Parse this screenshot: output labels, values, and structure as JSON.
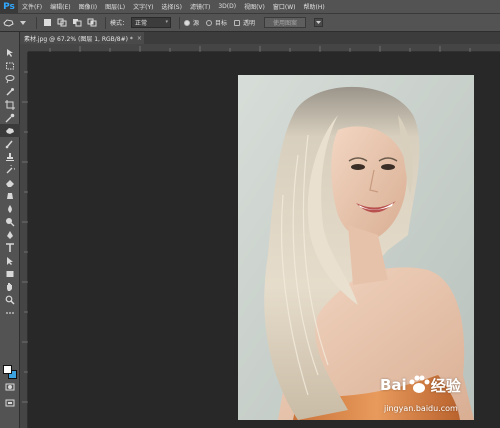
{
  "app": {
    "logo": "Ps"
  },
  "menu": [
    "文件(F)",
    "编辑(E)",
    "图像(I)",
    "图层(L)",
    "文字(Y)",
    "选择(S)",
    "滤镜(T)",
    "3D(D)",
    "视图(V)",
    "窗口(W)",
    "帮助(H)"
  ],
  "options": {
    "mode_label": "模式：",
    "mode_value": "正常",
    "radio_1": "源",
    "radio_2": "目标",
    "transparent_label": "透明",
    "use_pattern_label": "使用图案"
  },
  "document": {
    "tab_title": "素材.jpg @ 67.2% (图层 1, RGB/8#) *",
    "close_glyph": "×"
  },
  "colors": {
    "foreground": "#ffffff",
    "background": "#3ba3e0"
  },
  "tools": [
    "move-icon",
    "marquee-icon",
    "lasso-icon",
    "quick-select-icon",
    "crop-icon",
    "eyedropper-icon",
    "patch-icon",
    "brush-icon",
    "clone-stamp-icon",
    "history-brush-icon",
    "eraser-icon",
    "gradient-icon",
    "blur-icon",
    "dodge-icon",
    "pen-icon",
    "type-icon",
    "path-select-icon",
    "shape-icon",
    "hand-icon",
    "zoom-icon",
    "edit-toolbar-icon",
    "quick-mask-icon",
    "screen-mode-icon"
  ],
  "watermark": {
    "brand_left": "Bai",
    "brand_right": "经验",
    "url": "jingyan.baidu.com"
  }
}
